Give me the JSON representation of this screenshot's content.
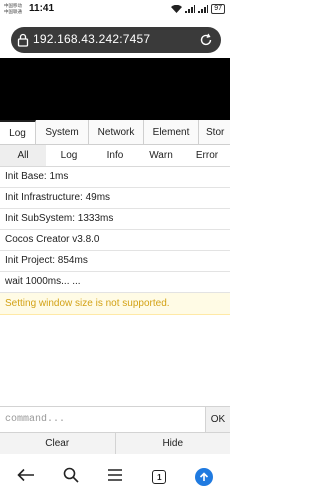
{
  "status_bar": {
    "carrier_1": "中国移动",
    "carrier_2": "中国联通",
    "time": "11:41",
    "battery": "97"
  },
  "browser": {
    "url": "192.168.43.242:7457"
  },
  "tabs": [
    {
      "label": "Log",
      "active": true
    },
    {
      "label": "System",
      "active": false
    },
    {
      "label": "Network",
      "active": false
    },
    {
      "label": "Element",
      "active": false
    },
    {
      "label": "Stor",
      "active": false
    }
  ],
  "filters": [
    {
      "label": "All",
      "active": true
    },
    {
      "label": "Log",
      "active": false
    },
    {
      "label": "Info",
      "active": false
    },
    {
      "label": "Warn",
      "active": false
    },
    {
      "label": "Error",
      "active": false
    }
  ],
  "logs": [
    {
      "text": "Init Base: 1ms",
      "level": "log"
    },
    {
      "text": "Init Infrastructure: 49ms",
      "level": "log"
    },
    {
      "text": "Init SubSystem: 1333ms",
      "level": "log"
    },
    {
      "text": "Cocos Creator v3.8.0",
      "level": "log"
    },
    {
      "text": "Init Project: 854ms",
      "level": "log"
    },
    {
      "text": "wait 1000ms... ...",
      "level": "log"
    },
    {
      "text": "Setting window size is not supported.",
      "level": "warn"
    }
  ],
  "command": {
    "placeholder": "command...",
    "ok_label": "OK"
  },
  "actions": {
    "clear_label": "Clear",
    "hide_label": "Hide"
  },
  "navbar": {
    "tab_count": "1"
  },
  "colors": {
    "url_bar": "#3a3a3a",
    "warn_bg": "#fffbe5",
    "warn_text": "#d3a216",
    "up_button": "#1f7ae0"
  }
}
